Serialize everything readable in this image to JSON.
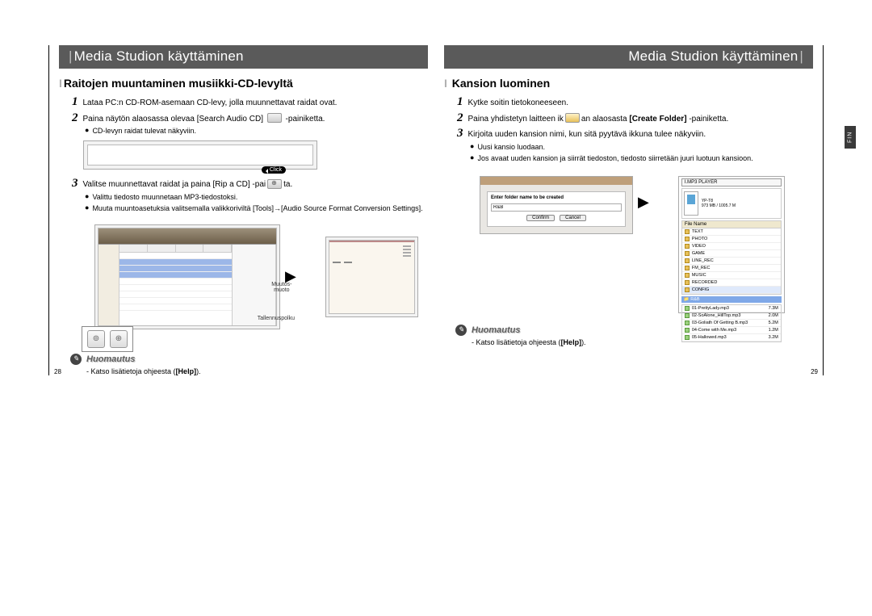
{
  "left": {
    "title": "Media Studion käyttäminen",
    "section": "Raitojen muuntaminen musiikki-CD-levyltä",
    "steps": {
      "s1": "Lataa PC:n CD-ROM-asemaan CD-levy, jolla muunnettavat raidat ovat.",
      "s2a": "Paina näytön alaosassa olevaa [Search Audio CD]",
      "s2b": "-painiketta.",
      "b2": "CD-levyn raidat tulevat näkyviin.",
      "s3a": "Valitse muunnettavat raidat ja paina [Rip a CD] -pai",
      "s3b": "ta.",
      "b3a": "Valittu tiedosto muunnetaan MP3-tiedostoksi.",
      "b3b": "Muuta muuntoasetuksia valitsemalla valikkoriviltä [Tools]→[Audio Source Format Conversion Settings]."
    },
    "labels": {
      "muutos": "Muutos-\nmuoto",
      "tallennus": "Tallennuspolku",
      "click": "Click"
    },
    "huom_title": "Huomautus",
    "huom_text_pre": "- Katso lisätietoja ohjeesta (",
    "huom_bold": "[Help]",
    "huom_text_post": ").",
    "page": "28"
  },
  "right": {
    "title": "Media Studion käyttäminen",
    "section": "Kansion luominen",
    "steps": {
      "s1": "Kytke soitin tietokoneeseen.",
      "s2a": "Paina yhdistetyn laitteen ik",
      "s2b": "an alaosasta",
      "s2c": "[Create Folder]",
      "s2d": "-painiketta.",
      "s3": "Kirjoita uuden kansion nimi, kun sitä pyytävä ikkuna tulee näkyviin.",
      "b3a": "Uusi kansio luodaan.",
      "b3b": "Jos avaat uuden kansion ja siirrät tiedoston, tiedosto siirretään juuri luotuun kansioon."
    },
    "dialog": {
      "label": "Enter folder name to be created",
      "value": "R&B",
      "confirm": "Confirm",
      "cancel": "Cancel"
    },
    "player": {
      "title": "I.MP3 PLAYER",
      "device": "YP-T8\n973 MB / 1005.7 M",
      "filehdr": "File Name",
      "folders": [
        "TEXT",
        "PHOTO",
        "VIDEO",
        "GAME",
        "LINE_REC",
        "FM_REC",
        "MUSIC",
        "RECORDED",
        "CONFIG"
      ],
      "newfolder": "R&B",
      "songs": [
        {
          "n": "01-PrettyLady.mp3",
          "t": "7.3M"
        },
        {
          "n": "02-SoAlone_HillTop.mp3",
          "t": "2.0M"
        },
        {
          "n": "03-Goliath Of Getting B.mp3",
          "t": "5.2M"
        },
        {
          "n": "04-Come with Me.mp3",
          "t": "1.2M"
        },
        {
          "n": "05-Hallowed.mp3",
          "t": "3.2M"
        }
      ]
    },
    "huom_title": "Huomautus",
    "huom_text_pre": "- Katso lisätietoja ohjeesta (",
    "huom_bold": "[Help]",
    "huom_text_post": ").",
    "page": "29",
    "fin": "FIN"
  }
}
